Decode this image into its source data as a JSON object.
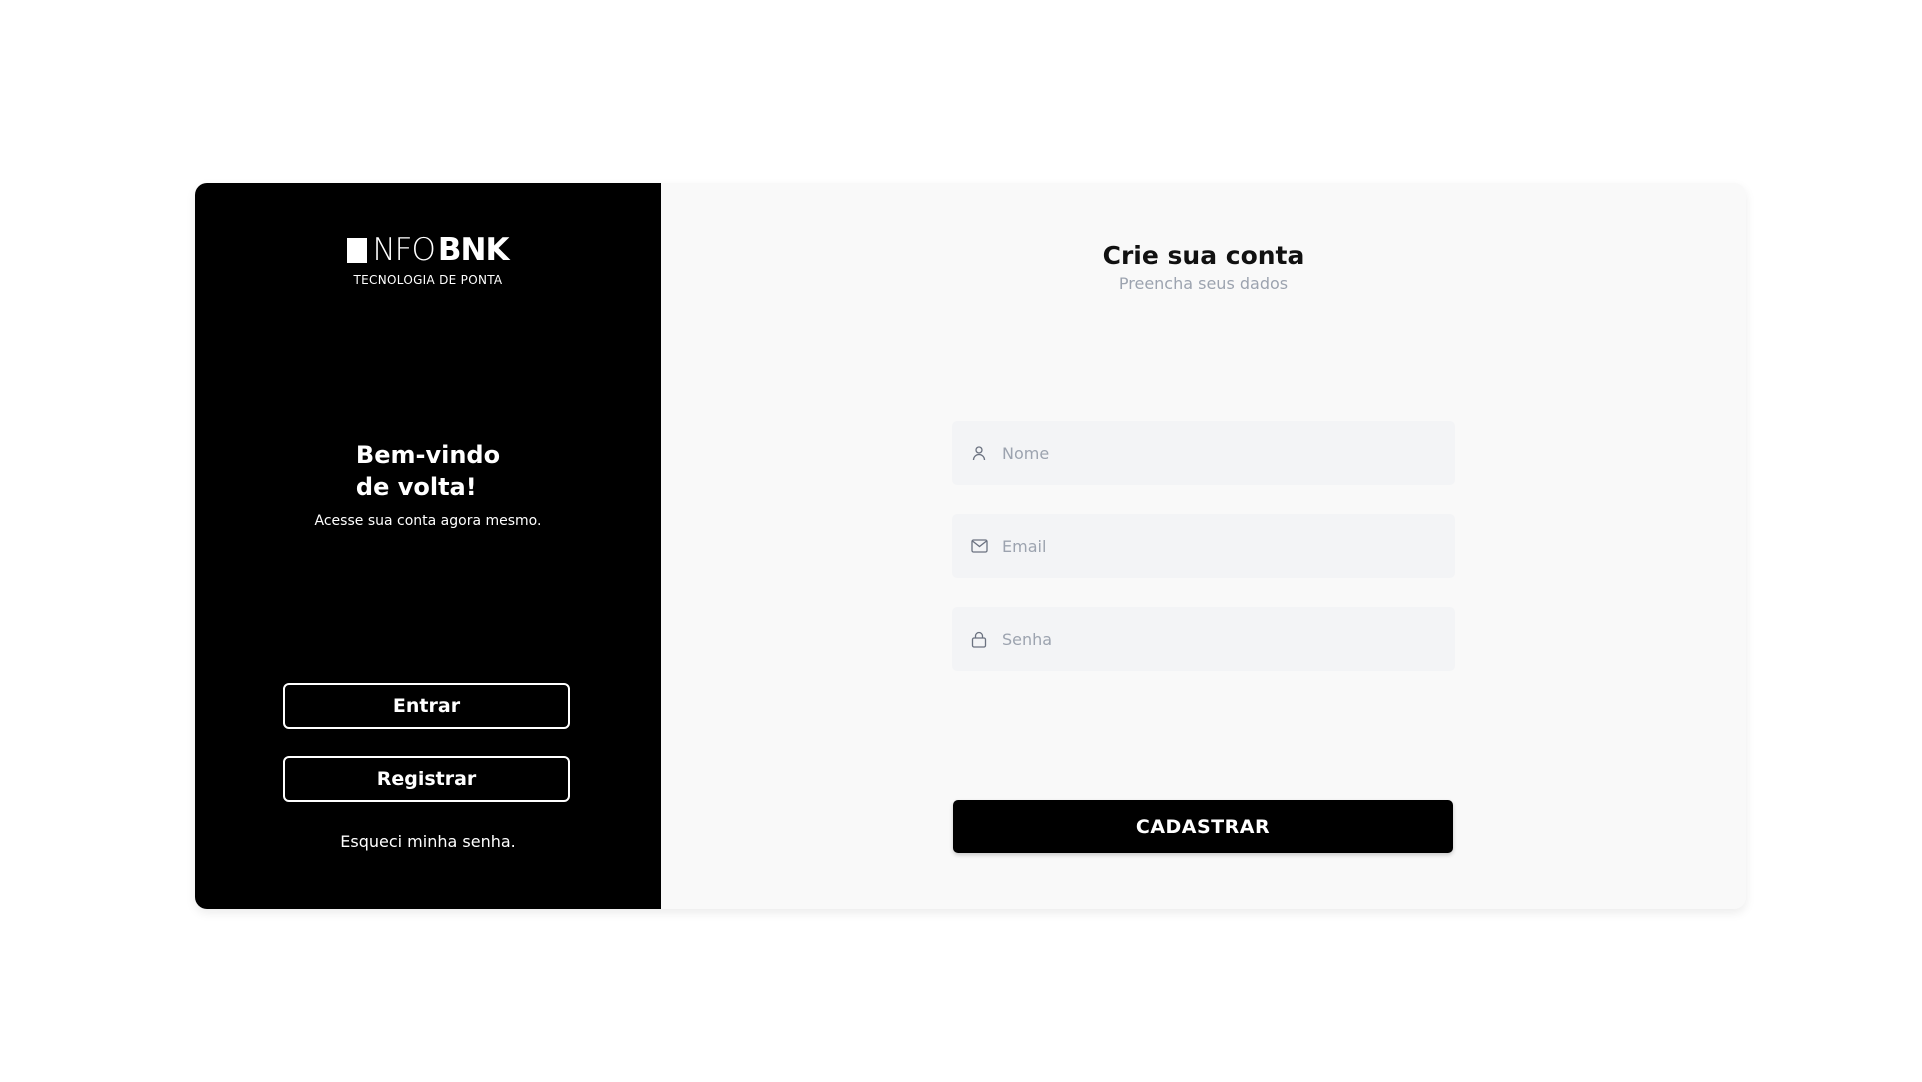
{
  "brand": {
    "logo_light": "NFO",
    "logo_bold": "BNK",
    "tagline": "TECNOLOGIA DE PONTA"
  },
  "welcome": {
    "title": "Bem-vindo\nde volta!",
    "subtitle": "Acesse sua conta agora mesmo."
  },
  "nav": {
    "login_label": "Entrar",
    "register_label": "Registrar",
    "forgot_label": "Esqueci minha senha."
  },
  "form": {
    "title": "Crie sua conta",
    "subtitle": "Preencha seus dados",
    "fields": [
      {
        "icon": "user-icon",
        "placeholder": "Nome",
        "value": ""
      },
      {
        "icon": "mail-icon",
        "placeholder": "Email",
        "value": ""
      },
      {
        "icon": "lock-icon",
        "placeholder": "Senha",
        "value": ""
      }
    ],
    "submit_label": "CADASTRAR"
  },
  "colors": {
    "left_panel": "#000000",
    "right_panel": "#f9f9f9",
    "field_bg": "#f3f4f6",
    "placeholder": "#9ca3af"
  }
}
